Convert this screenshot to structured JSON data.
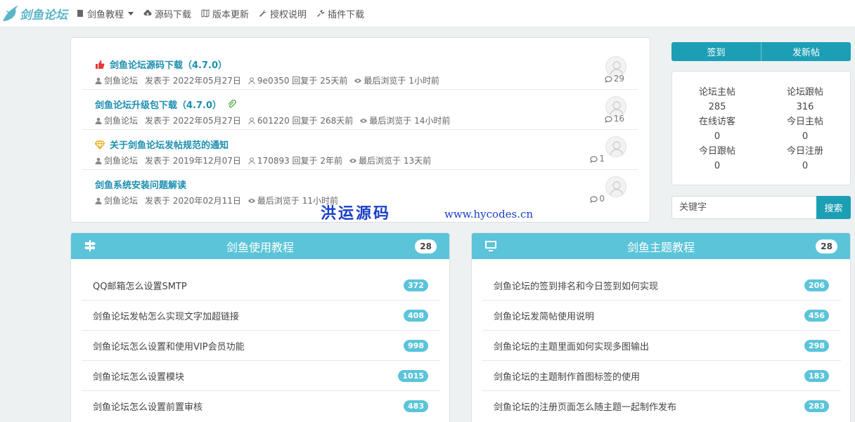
{
  "brand": {
    "name": "剑鱼论坛"
  },
  "nav": [
    {
      "label": "剑鱼教程",
      "icon": "book-icon",
      "dropdown": true
    },
    {
      "label": "源码下载",
      "icon": "cloud-download-icon"
    },
    {
      "label": "版本更新",
      "icon": "map-icon"
    },
    {
      "label": "授权说明",
      "icon": "wrench-icon"
    },
    {
      "label": "插件下载",
      "icon": "plug-icon"
    }
  ],
  "threads": [
    {
      "title": "剑鱼论坛源码下载（4.7.0）",
      "icon": "thumbs-up-icon",
      "author": "剑鱼论坛",
      "posted": "发表于 2022年05月27日",
      "last_reply": "9e0350 回复于 25天前",
      "viewed": "最后浏览于 1小时前",
      "replies": "29"
    },
    {
      "title": "剑鱼论坛升级包下载（4.7.0）",
      "icon": "paperclip-icon",
      "author": "剑鱼论坛",
      "posted": "发表于 2022年05月27日",
      "last_reply": "601220 回复于 268天前",
      "viewed": "最后浏览于 14小时前",
      "replies": "16"
    },
    {
      "title": "关于剑鱼论坛发帖规范的通知",
      "icon": "diamond-icon",
      "author": "剑鱼论坛",
      "posted": "发表于 2019年12月07日",
      "last_reply": "170893 回复于 2年前",
      "viewed": "最后浏览于 13天前",
      "replies": "1"
    },
    {
      "title": "剑鱼系统安装问题解读",
      "icon": "",
      "author": "剑鱼论坛",
      "posted": "发表于 2020年02月11日",
      "last_reply": "",
      "viewed": "最后浏览于 11小时前",
      "replies": "0"
    }
  ],
  "actions": {
    "signin": "签到",
    "new_post": "发新帖"
  },
  "stats": [
    {
      "label": "论坛主帖",
      "value": "285"
    },
    {
      "label": "论坛跟帖",
      "value": "316"
    },
    {
      "label": "在线访客",
      "value": "0"
    },
    {
      "label": "今日主帖",
      "value": "0"
    },
    {
      "label": "今日跟帖",
      "value": "0"
    },
    {
      "label": "今日注册",
      "value": "0"
    }
  ],
  "search": {
    "placeholder": "关键字",
    "button": "搜索"
  },
  "watermark": {
    "text": "洪运源码",
    "url": "www.hycodes.cn"
  },
  "panels": [
    {
      "title": "剑鱼使用教程",
      "icon": "signpost-icon",
      "count": "28",
      "items": [
        {
          "label": "QQ邮箱怎么设置SMTP",
          "count": "372"
        },
        {
          "label": "剑鱼论坛发帖怎么实现文字加超链接",
          "count": "408"
        },
        {
          "label": "剑鱼论坛怎么设置和使用VIP会员功能",
          "count": "998"
        },
        {
          "label": "剑鱼论坛怎么设置模块",
          "count": "1015"
        },
        {
          "label": "剑鱼论坛怎么设置前置审核",
          "count": "483"
        }
      ]
    },
    {
      "title": "剑鱼主题教程",
      "icon": "monitor-icon",
      "count": "28",
      "items": [
        {
          "label": "剑鱼论坛的签到排名和今日签到如何实现",
          "count": "206"
        },
        {
          "label": "剑鱼论坛发简帖使用说明",
          "count": "456"
        },
        {
          "label": "剑鱼论坛的主题里面如何实现多图输出",
          "count": "298"
        },
        {
          "label": "剑鱼论坛的主题制作首图标签的使用",
          "count": "183"
        },
        {
          "label": "剑鱼论坛的注册页面怎么随主题一起制作发布",
          "count": "283"
        }
      ]
    }
  ],
  "colors": {
    "accent": "#1c9fb5",
    "panel_header": "#5bc4d9",
    "link": "#1c8fb0"
  }
}
